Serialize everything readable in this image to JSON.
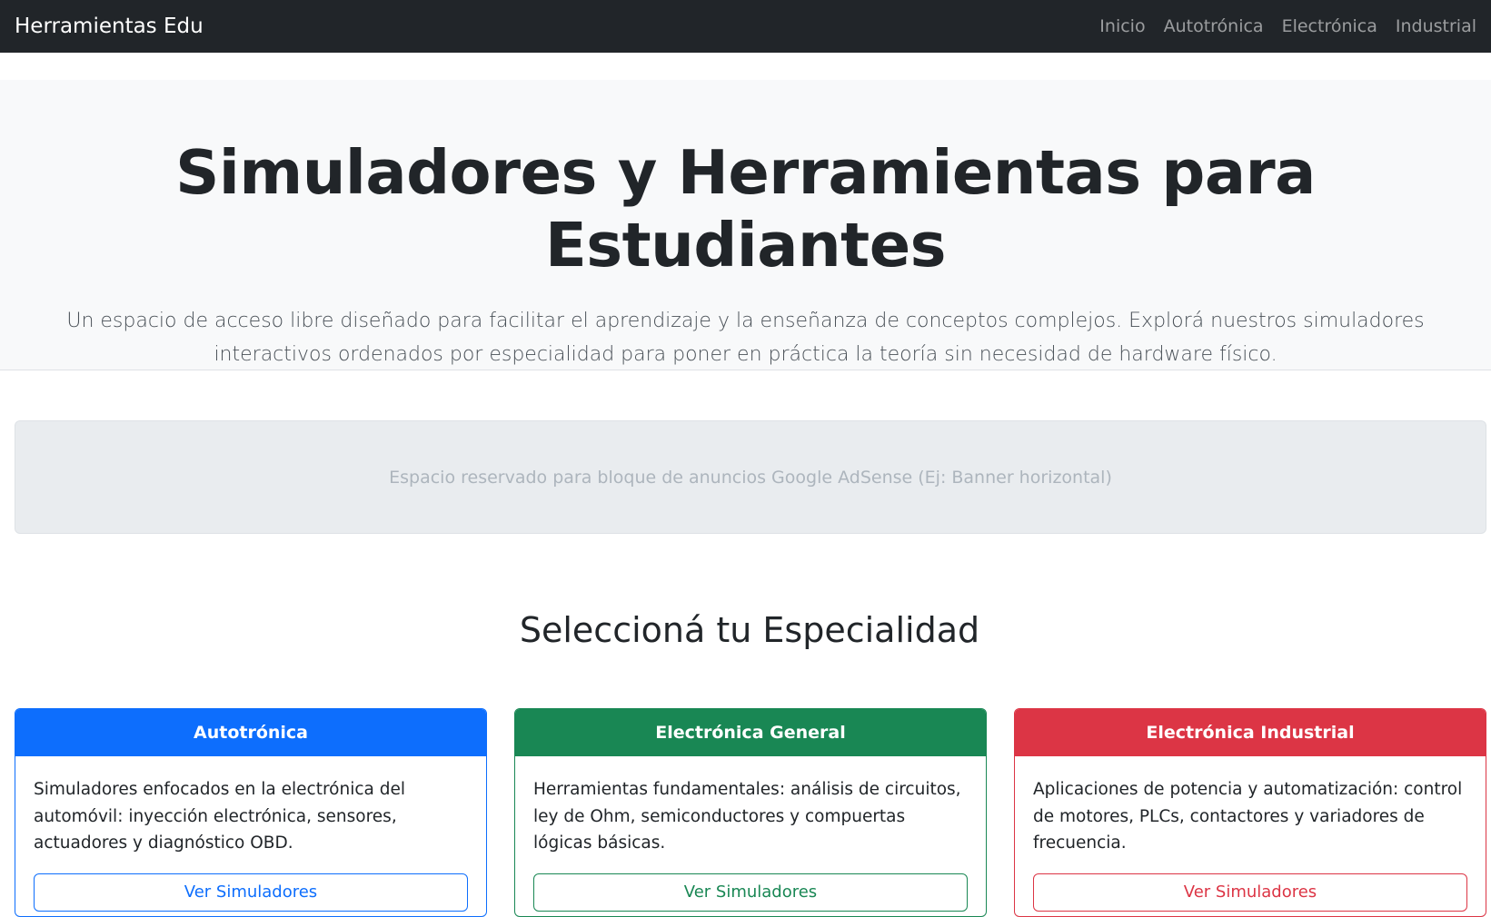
{
  "navbar": {
    "brand": "Herramientas Edu",
    "links": [
      {
        "label": "Inicio"
      },
      {
        "label": "Autotrónica"
      },
      {
        "label": "Electrónica"
      },
      {
        "label": "Industrial"
      }
    ]
  },
  "hero": {
    "title": "Simuladores y Herramientas para Estudiantes",
    "subtitle": "Un espacio de acceso libre diseñado para facilitar el aprendizaje y la enseñanza de conceptos complejos. Explorá nuestros simuladores interactivos ordenados por especialidad para poner en práctica la teoría sin necesidad de hardware físico."
  },
  "ad": {
    "text": "Espacio reservado para bloque de anuncios Google AdSense (Ej: Banner horizontal)"
  },
  "section": {
    "title": "Seleccioná tu Especialidad"
  },
  "cards": [
    {
      "title": "Autotrónica",
      "text": "Simuladores enfocados en la electrónica del automóvil: inyección electrónica, sensores, actuadores y diagnóstico OBD.",
      "button": "Ver Simuladores",
      "color": "#0d6efd"
    },
    {
      "title": "Electrónica General",
      "text": "Herramientas fundamentales: análisis de circuitos, ley de Ohm, semiconductores y compuertas lógicas básicas.",
      "button": "Ver Simuladores",
      "color": "#198754"
    },
    {
      "title": "Electrónica Industrial",
      "text": "Aplicaciones de potencia y automatización: control de motores, PLCs, contactores y variadores de frecuencia.",
      "button": "Ver Simuladores",
      "color": "#dc3545"
    }
  ]
}
